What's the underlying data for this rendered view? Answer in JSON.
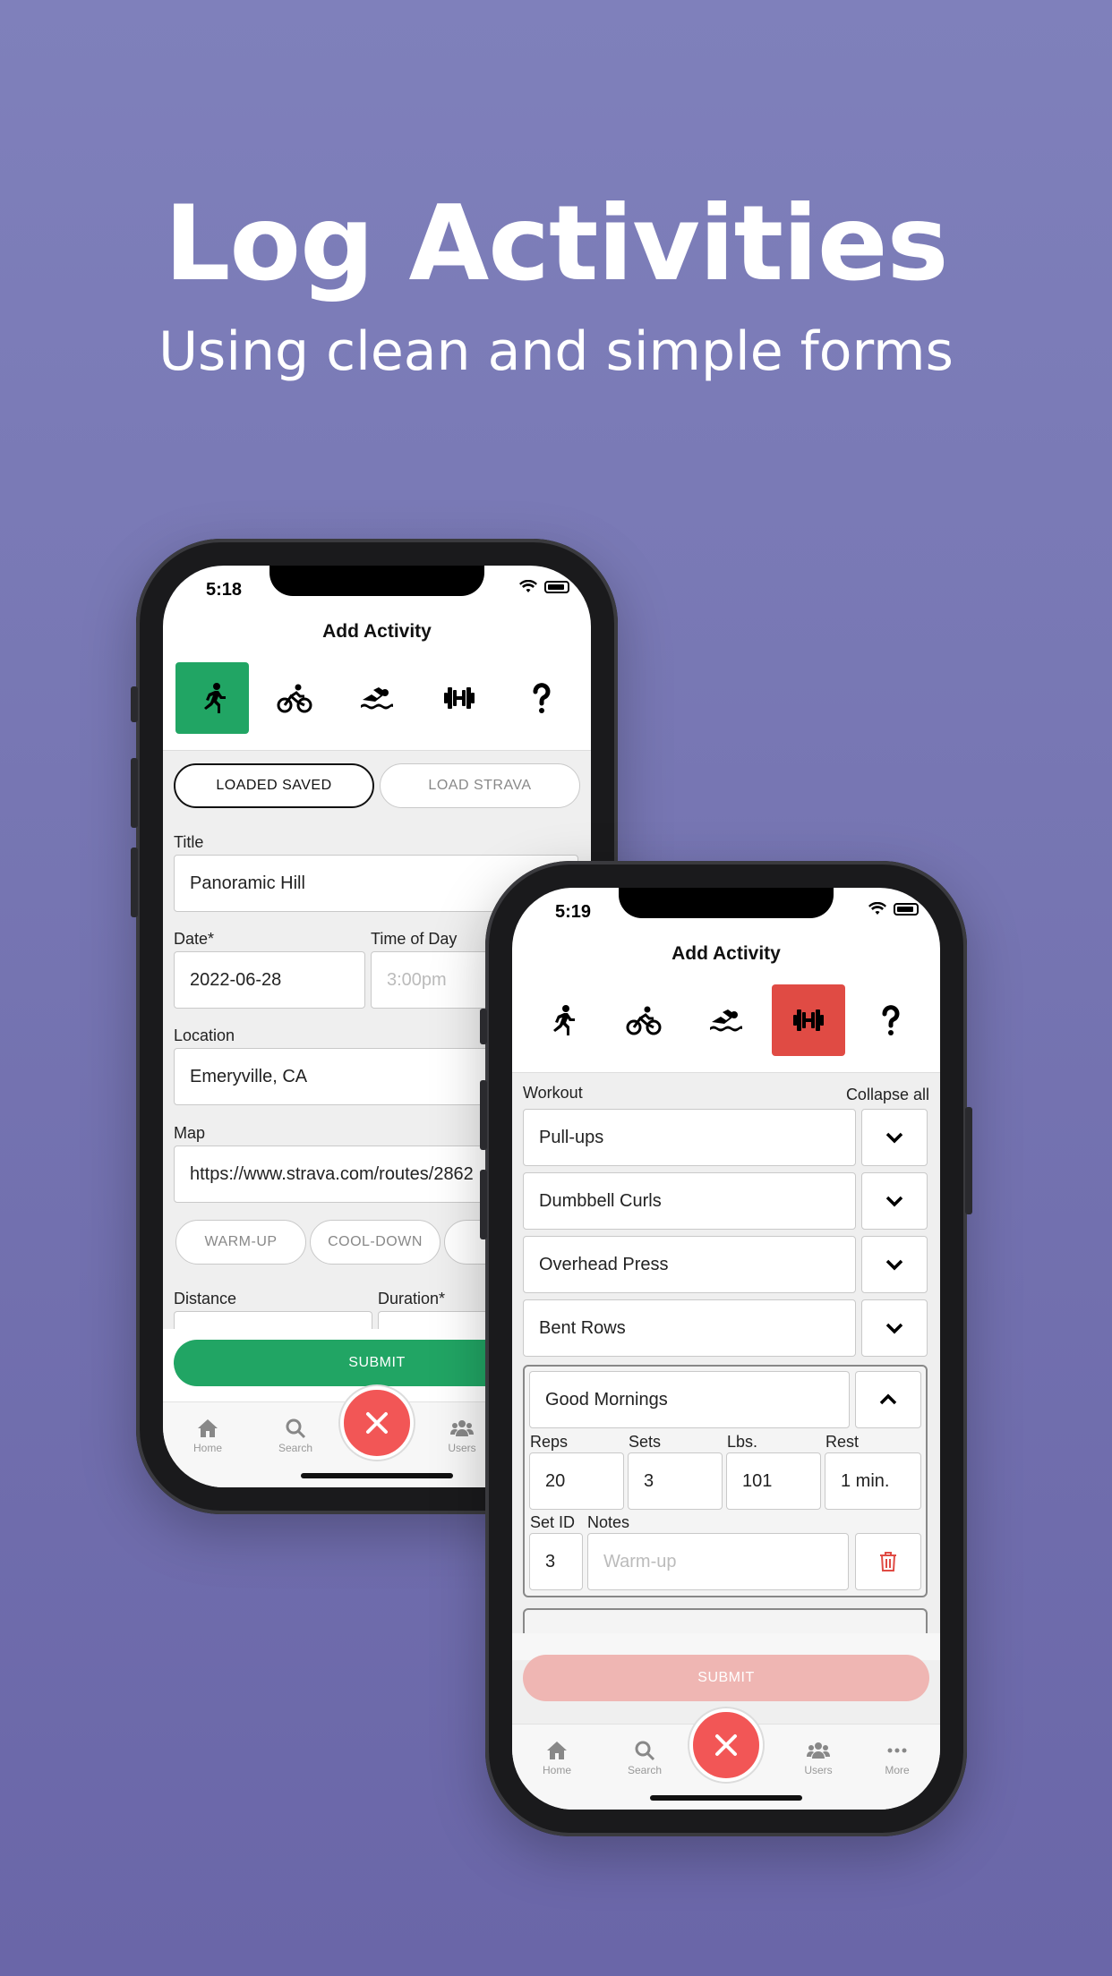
{
  "headline": "Log Activities",
  "subhead": "Using clean and simple forms",
  "phone1": {
    "time": "5:18",
    "title": "Add Activity",
    "buttons": {
      "loaded_saved": "LOADED SAVED",
      "load_strava": "LOAD STRAVA"
    },
    "labels": {
      "title": "Title",
      "date": "Date*",
      "time_of_day": "Time of Day",
      "location": "Location",
      "map": "Map",
      "distance": "Distance",
      "duration": "Duration*"
    },
    "values": {
      "title": "Panoramic Hill",
      "date": "2022-06-28",
      "time_placeholder": "3:00pm",
      "location": "Emeryville, CA",
      "map": "https://www.strava.com/routes/2862"
    },
    "tags": [
      "WARM-UP",
      "COOL-DOWN"
    ],
    "submit": "SUBMIT",
    "submit_color": "#21a564",
    "active_color": "#21a564",
    "tabs": [
      "Home",
      "Search",
      "Users"
    ]
  },
  "phone2": {
    "time": "5:19",
    "title": "Add Activity",
    "workout_label": "Workout",
    "collapse_all": "Collapse all",
    "exercises": [
      "Pull-ups",
      "Dumbbell Curls",
      "Overhead Press",
      "Bent Rows"
    ],
    "expanded": {
      "name": "Good Mornings",
      "labels": {
        "reps": "Reps",
        "sets": "Sets",
        "lbs": "Lbs.",
        "rest": "Rest",
        "set_id": "Set ID",
        "notes": "Notes"
      },
      "values": {
        "reps": "20",
        "sets": "3",
        "lbs": "101",
        "rest": "1 min.",
        "set_id": "3",
        "notes_placeholder": "Warm-up"
      }
    },
    "submit": "SUBMIT",
    "submit_color": "#efb6b3",
    "active_color": "#e04b44",
    "tabs": [
      "Home",
      "Search",
      "Users",
      "More"
    ]
  }
}
